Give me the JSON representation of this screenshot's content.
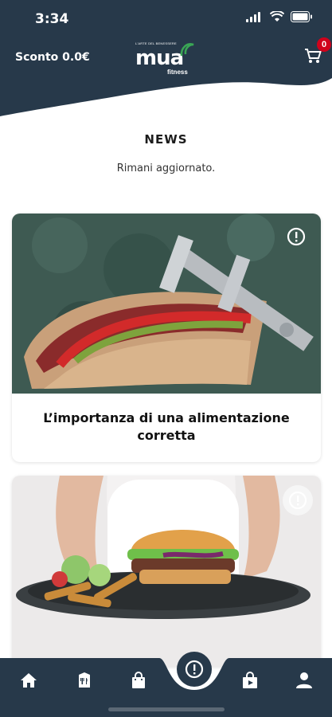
{
  "status_bar": {
    "time": "3:34"
  },
  "header": {
    "discount_label": "Sconto 0.0€",
    "logo": {
      "tagline": "L'ARTE DEL BENESSERE",
      "main": "mua",
      "sub": "fitness"
    },
    "cart_count": "0",
    "colors": {
      "navy": "#27394a",
      "accent_green": "#3aa655",
      "badge_red": "#d0021b"
    }
  },
  "page": {
    "title": "NEWS",
    "subtitle": "Rimani aggiornato."
  },
  "news": [
    {
      "title": "L’importanza di una alimentazione corretta",
      "image": "sandwich-with-caliper",
      "icon": "alert-circle-icon"
    },
    {
      "title": "",
      "image": "burger-and-fries-plate",
      "icon": "alert-circle-icon"
    }
  ],
  "bottom_nav": {
    "items": [
      "home-icon",
      "restaurant-menu-icon",
      "shopping-bag-icon",
      "news-icon",
      "video-bag-icon",
      "profile-icon"
    ]
  }
}
